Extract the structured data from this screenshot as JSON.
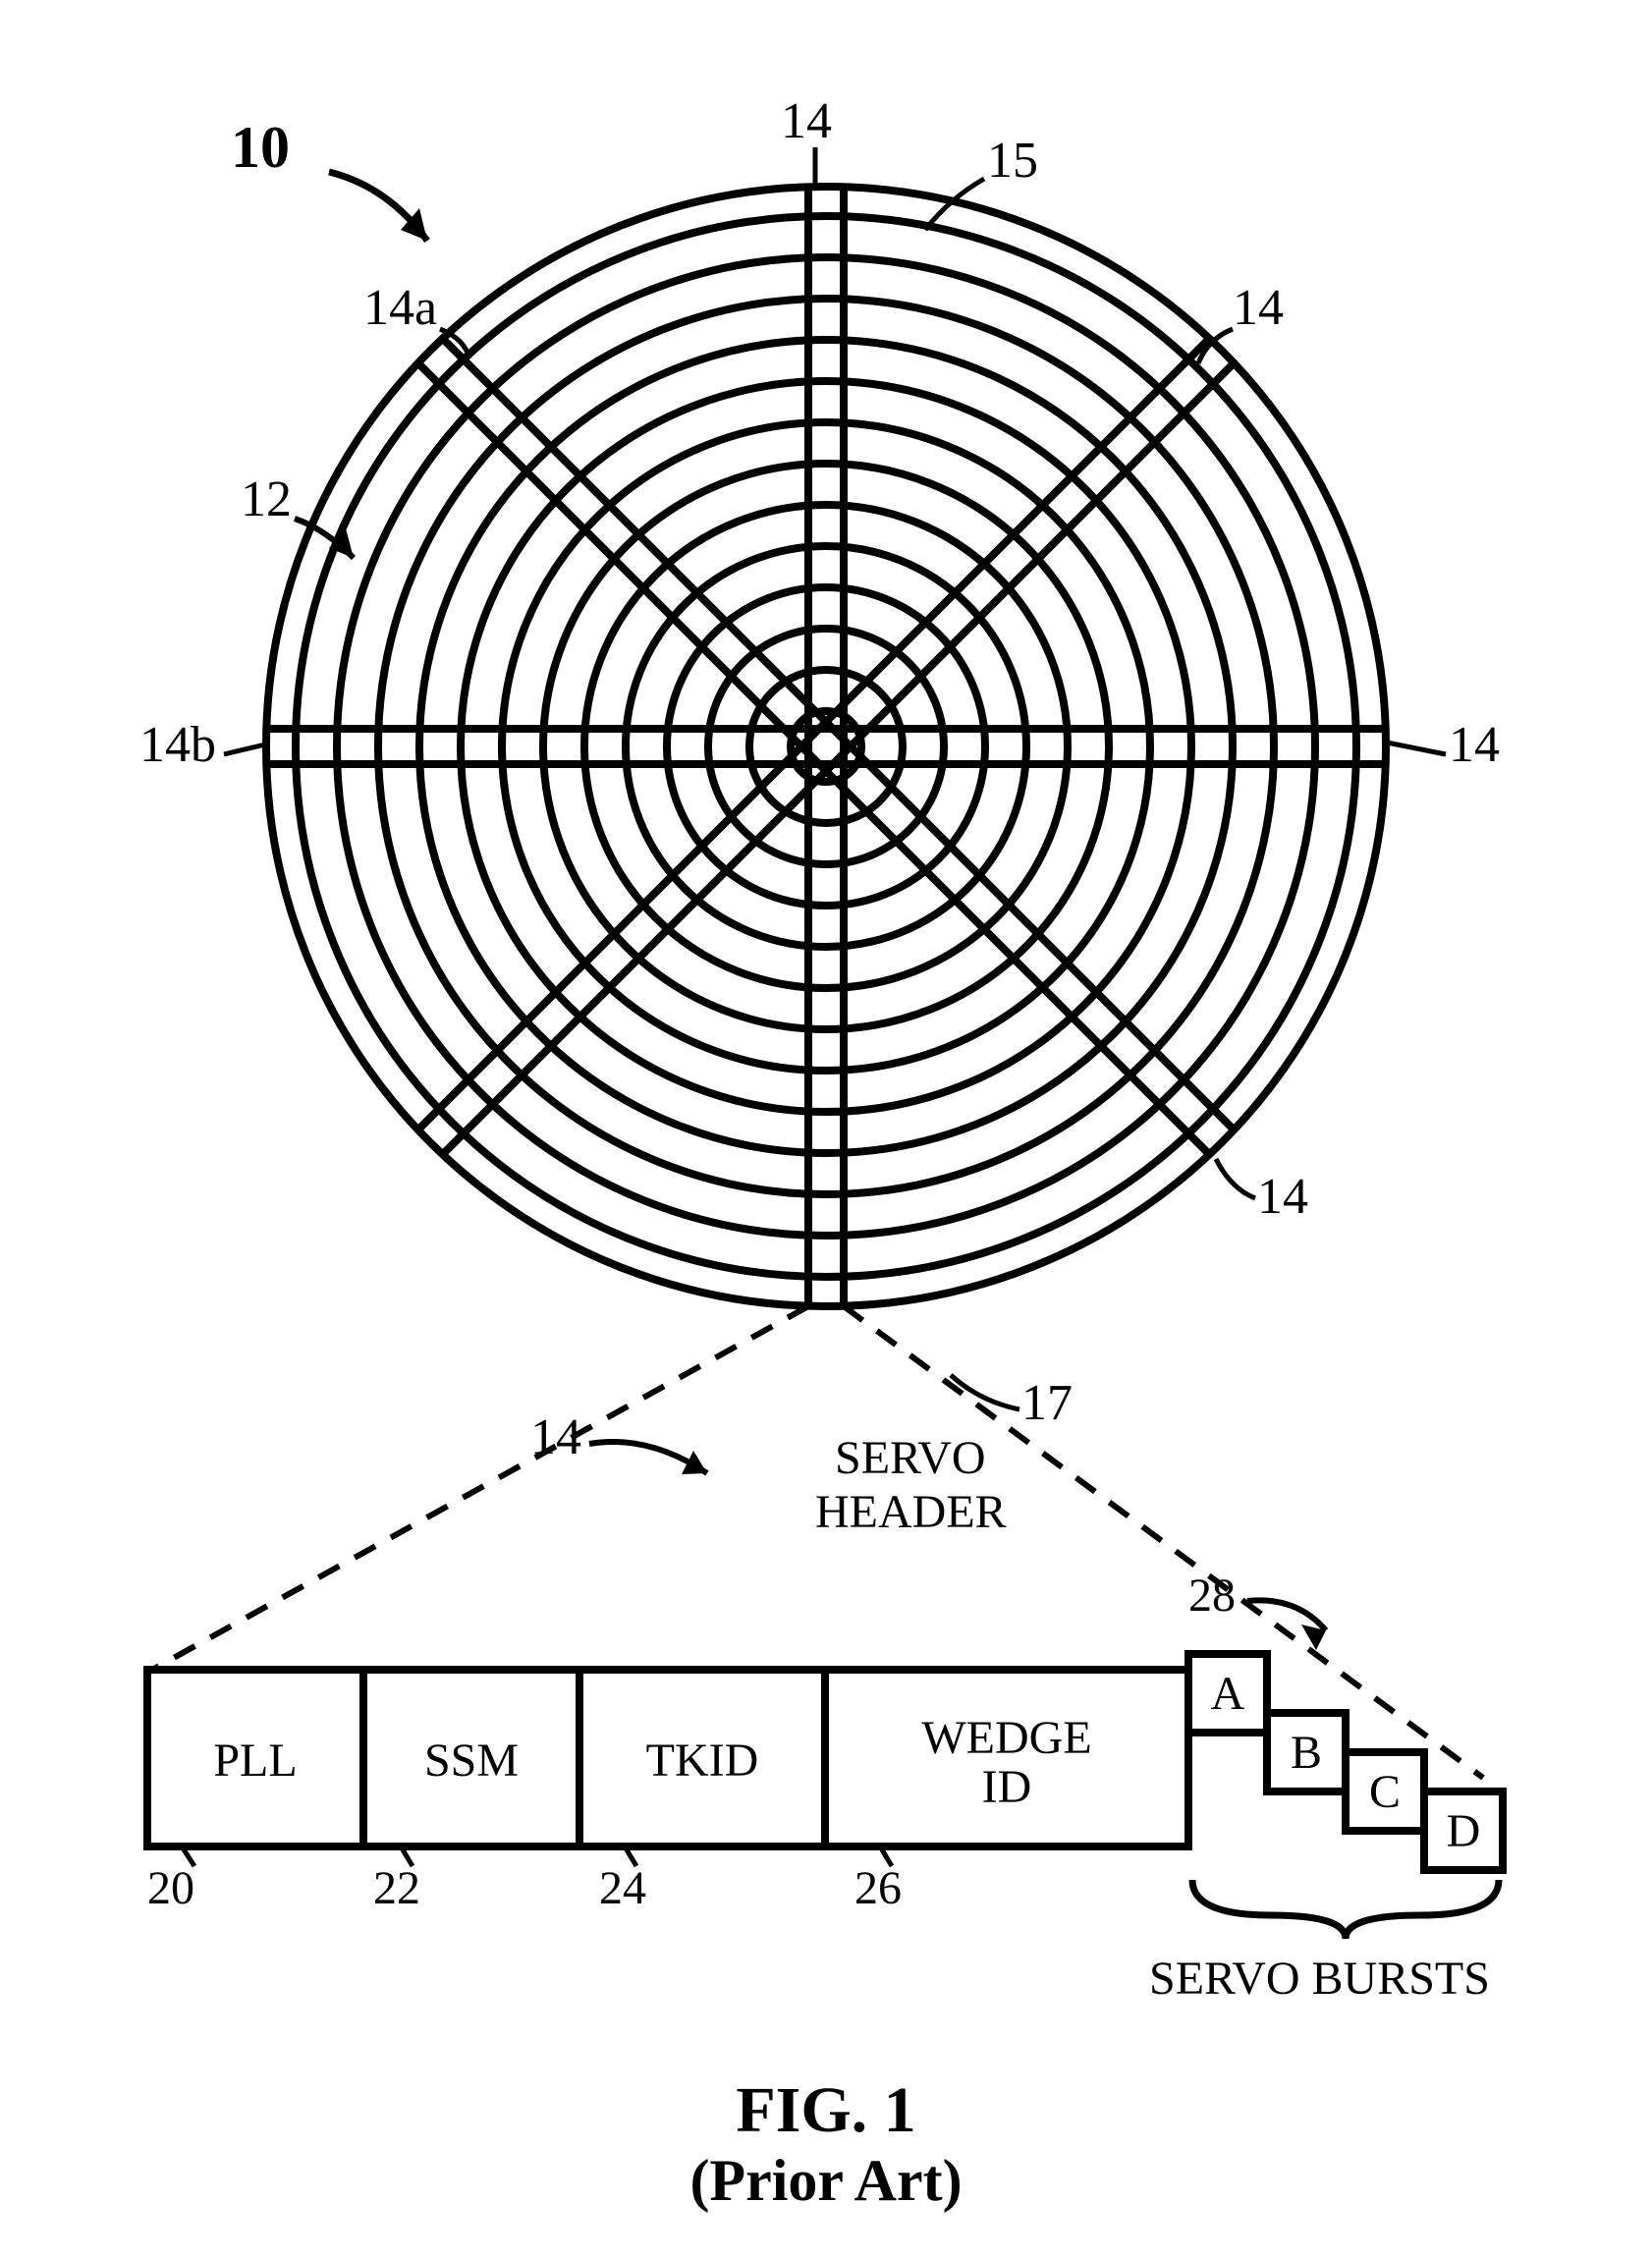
{
  "figure": {
    "number_label": "10",
    "caption_line1": "FIG. 1",
    "caption_line2": "(Prior Art)"
  },
  "disk_labels": {
    "top_spoke": "14",
    "top_left_spoke": "14a",
    "left_spoke": "14b",
    "left_region": "12",
    "right_outer_track": "15",
    "top_right_spoke": "14",
    "right_spoke": "14",
    "bottom_right_spoke": "14",
    "bottom_spoke_left": "14",
    "detail_ref": "17",
    "detail_ref_title1": "SERVO",
    "detail_ref_title2": "HEADER"
  },
  "servo_header": {
    "fields": {
      "pll": "PLL",
      "ssm": "SSM",
      "tkid": "TKID",
      "wedge_line1": "WEDGE",
      "wedge_line2": "ID"
    },
    "field_refs": {
      "pll": "20",
      "ssm": "22",
      "tkid": "24",
      "wedge": "26"
    },
    "bursts": {
      "a": "A",
      "b": "B",
      "c": "C",
      "d": "D"
    },
    "bursts_group_ref": "28",
    "bursts_label": "SERVO BURSTS"
  }
}
